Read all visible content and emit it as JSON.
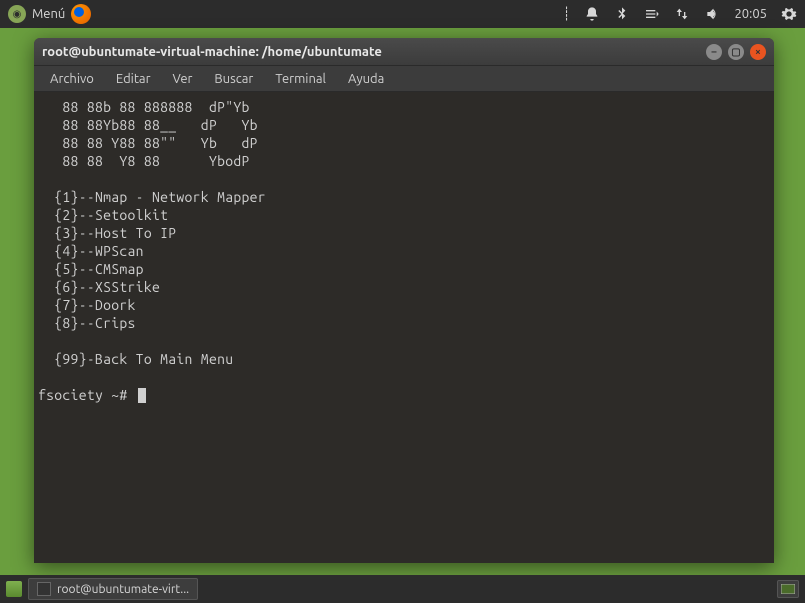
{
  "topbar": {
    "menu_label": "Menú",
    "time": "20:05"
  },
  "window": {
    "title": "root@ubuntumate-virtual-machine: /home/ubuntumate"
  },
  "menubar": {
    "file": "Archivo",
    "edit": "Editar",
    "view": "Ver",
    "search": "Buscar",
    "terminal": "Terminal",
    "help": "Ayuda"
  },
  "terminal": {
    "ascii1": "   88 88b 88 888888  dP\"Yb",
    "ascii2": "   88 88Yb88 88__   dP   Yb",
    "ascii3": "   88 88 Y88 88\"\"   Yb   dP",
    "ascii4": "   88 88  Y8 88      YbodP",
    "opt1": "  {1}--Nmap - Network Mapper",
    "opt2": "  {2}--Setoolkit",
    "opt3": "  {3}--Host To IP",
    "opt4": "  {4}--WPScan",
    "opt5": "  {5}--CMSmap",
    "opt6": "  {6}--XSStrike",
    "opt7": "  {7}--Doork",
    "opt8": "  {8}--Crips",
    "opt99": "  {99}-Back To Main Menu",
    "prompt": "fsociety ~# "
  },
  "taskbar": {
    "app_label": "root@ubuntumate-virt..."
  }
}
